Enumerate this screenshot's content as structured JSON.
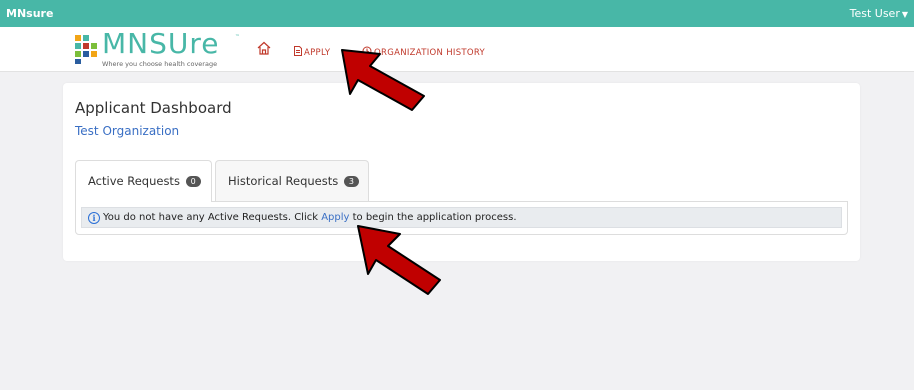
{
  "topbar": {
    "brand": "MNsure",
    "user": "Test User"
  },
  "nav": {
    "logo_word": "MNSUre",
    "logo_tagline": "Where you choose health coverage",
    "home_icon": "home-icon",
    "apply": "APPLY",
    "org_history": "ORGANIZATION HISTORY"
  },
  "dashboard": {
    "title": "Applicant Dashboard",
    "organization": "Test Organization",
    "tabs": [
      {
        "label": "Active Requests",
        "count": "0"
      },
      {
        "label": "Historical Requests",
        "count": "3"
      }
    ],
    "alert": {
      "before": "You do not have any Active Requests. Click ",
      "link": "Apply",
      "after": " to begin the application process."
    }
  },
  "colors": {
    "topbar": "#48b7a7",
    "nav_link": "#c0392b",
    "link": "#3a6fc4",
    "arrow": "#c00000"
  }
}
